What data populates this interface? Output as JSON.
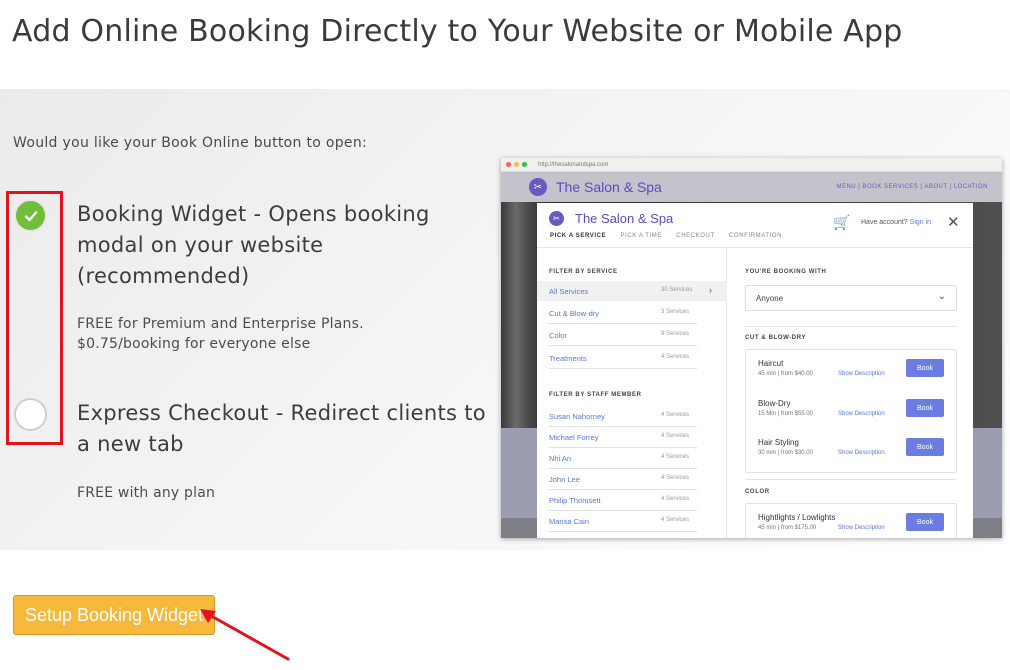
{
  "page": {
    "title": "Add Online Booking Directly to Your Website or Mobile App",
    "question": "Would you like your Book Online button to open:"
  },
  "options": [
    {
      "title": "Booking Widget - Opens booking modal on your website (recommended)",
      "desc1": "FREE for Premium and Enterprise Plans.",
      "desc2": "$0.75/booking for everyone else",
      "selected": true
    },
    {
      "title": "Express Checkout - Redirect clients to a new tab",
      "desc1": "FREE with any plan",
      "selected": false
    }
  ],
  "setup_button": "Setup Booking Widget",
  "colors": {
    "accent_green": "#6fbf3a",
    "button_orange": "#f6b93b",
    "highlight_red": "#e0141c",
    "brand_purple": "#5e4bbf",
    "book_blue": "#6b7de0"
  },
  "preview": {
    "url": "http://thesalonandspa.com",
    "site_name": "The Salon & Spa",
    "site_nav": "MENU | BOOK SERVICES | ABOUT | LOCATION",
    "modal": {
      "name": "The Salon & Spa",
      "steps": [
        "PICK A SERVICE",
        "PICK A TIME",
        "CHECKOUT",
        "CONFIRMATION"
      ],
      "cart_count": "0",
      "account_text": "Have account?",
      "sign_in": "Sign in",
      "filter_service_label": "FILTER BY SERVICE",
      "services": [
        {
          "name": "All Services",
          "count": "30 Services"
        },
        {
          "name": "Cut & Blow-dry",
          "count": "3 Services"
        },
        {
          "name": "Color",
          "count": "9 Services"
        },
        {
          "name": "Treatments",
          "count": "4 Services"
        }
      ],
      "filter_staff_label": "FILTER BY STAFF MEMBER",
      "staff": [
        {
          "name": "Susan Nahorney",
          "count": "4 Services"
        },
        {
          "name": "Michael Forrey",
          "count": "4 Services"
        },
        {
          "name": "Nhi An",
          "count": "4 Services"
        },
        {
          "name": "John Lee",
          "count": "4 Services"
        },
        {
          "name": "Philip Thomsett",
          "count": "4 Services"
        },
        {
          "name": "Marisa Cain",
          "count": "4 Services"
        }
      ],
      "booking_with_label": "YOU'RE BOOKING WITH",
      "booking_with_value": "Anyone",
      "cut_label": "CUT & BLOW-DRY",
      "cut_items": [
        {
          "name": "Haircut",
          "meta": "45 min | from $40.00",
          "desc": "Show Description",
          "book": "Book"
        },
        {
          "name": "Blow-Dry",
          "meta": "15 Min | from $55.00",
          "desc": "Show Description",
          "book": "Book"
        },
        {
          "name": "Hair Styling",
          "meta": "30 min | from $30.00",
          "desc": "Show Description",
          "book": "Book"
        }
      ],
      "color_label": "COLOR",
      "color_items": [
        {
          "name": "Hightlights / Lowlights",
          "meta": "45 min | from $175.00",
          "desc": "Show Description",
          "book": "Book"
        }
      ]
    }
  }
}
